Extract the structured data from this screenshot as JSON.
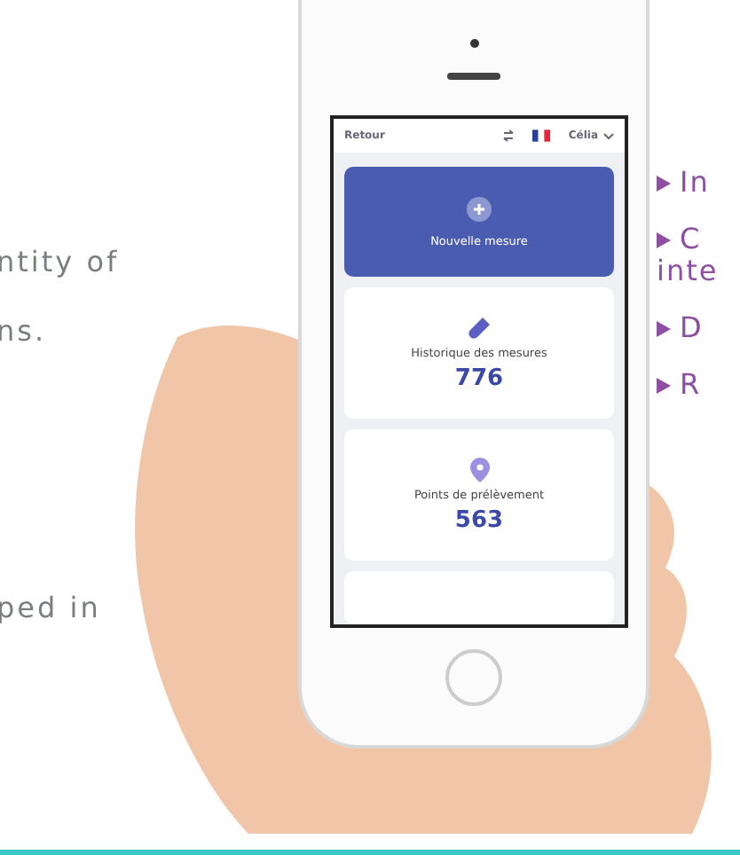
{
  "left_text": [
    "ntity of",
    "ns.",
    "ped in"
  ],
  "phone": {
    "header": {
      "back": "Retour",
      "user": "Célia"
    },
    "cards": [
      {
        "kind": "action",
        "label": "Nouvelle mesure"
      },
      {
        "kind": "history",
        "label": "Historique des mesures",
        "value": "776"
      },
      {
        "kind": "points",
        "label": "Points de prélèvement",
        "value": "563"
      },
      {
        "kind": "empty"
      }
    ]
  },
  "bullets": [
    {
      "lines": [
        "In"
      ]
    },
    {
      "lines": [
        "C",
        "inte"
      ]
    },
    {
      "lines": [
        "D"
      ]
    },
    {
      "lines": [
        "R"
      ]
    }
  ]
}
